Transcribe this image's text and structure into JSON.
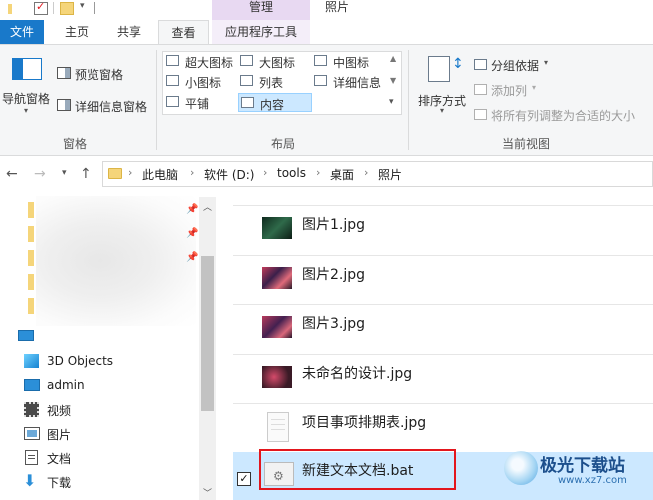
{
  "title_bar": {
    "context_header": "管理",
    "window_title": "照片"
  },
  "tabs": [
    {
      "label": "文件"
    },
    {
      "label": "主页"
    },
    {
      "label": "共享"
    },
    {
      "label": "查看"
    },
    {
      "label": "应用程序工具"
    }
  ],
  "ribbon": {
    "panes": {
      "nav_pane": "导航窗格",
      "preview_pane": "预览窗格",
      "details_pane": "详细信息窗格",
      "group_label": "窗格"
    },
    "layout": {
      "items": [
        "超大图标",
        "大图标",
        "中图标",
        "小图标",
        "列表",
        "详细信息",
        "平铺",
        "内容"
      ],
      "selected": "内容",
      "group_label": "布局"
    },
    "current_view": {
      "sort_by": "排序方式",
      "group_by": "分组依据",
      "add_columns": "添加列",
      "size_all_columns": "将所有列调整为合适的大小",
      "group_label": "当前视图"
    }
  },
  "address": {
    "crumbs": [
      "此电脑",
      "软件 (D:)",
      "tools",
      "桌面",
      "照片"
    ]
  },
  "nav_pane": {
    "items": [
      {
        "label": "3D Objects",
        "icon": "3d-objects-icon"
      },
      {
        "label": "admin",
        "icon": "desktop-icon"
      },
      {
        "label": "视频",
        "icon": "video-icon"
      },
      {
        "label": "图片",
        "icon": "pictures-icon"
      },
      {
        "label": "文档",
        "icon": "documents-icon"
      },
      {
        "label": "下载",
        "icon": "download-icon"
      }
    ]
  },
  "files": [
    {
      "name": "图片1.jpg",
      "thumb_color": "#1d3b2c"
    },
    {
      "name": "图片2.jpg",
      "thumb_color": "#6a2840"
    },
    {
      "name": "图片3.jpg",
      "thumb_color": "#5b2b4a"
    },
    {
      "name": "未命名的设计.jpg",
      "thumb_color": "#3a1a26"
    },
    {
      "name": "项目事项排期表.jpg",
      "thumb_color": "#f3f3f3"
    },
    {
      "name": "新建文本文档.bat",
      "thumb_color": "#e6e6e6",
      "selected": true
    }
  ],
  "watermark": {
    "text": "极光下载站",
    "url_text": "www.xz7.com"
  },
  "colors": {
    "file_tab": "#1979ca",
    "selection": "#cce8ff",
    "highlight_box": "#e3161d",
    "context_tab": "#e8d9f2"
  }
}
